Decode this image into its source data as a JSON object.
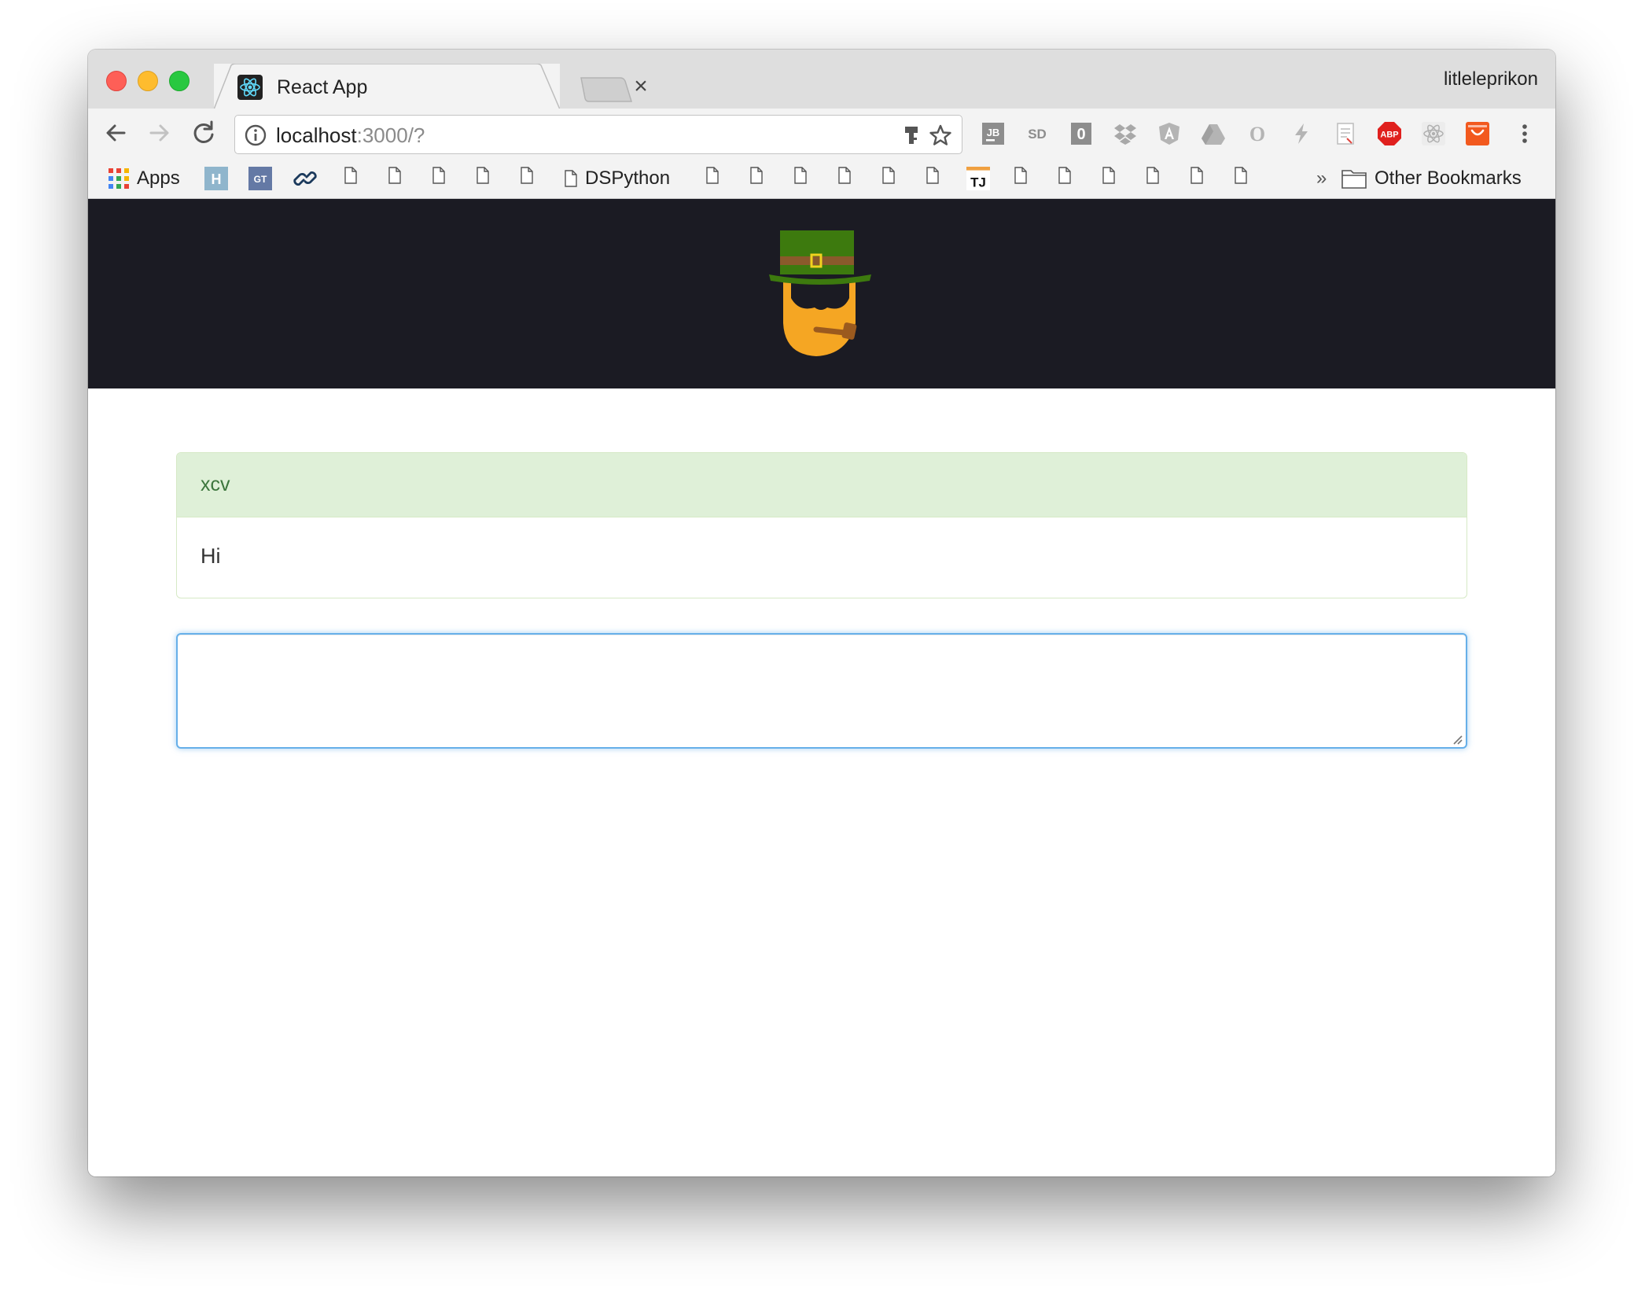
{
  "browser": {
    "tab": {
      "title": "React App",
      "close_glyph": "×"
    },
    "profile_name": "litleleprikon",
    "address": {
      "host": "localhost",
      "rest": ":3000/?"
    },
    "extensions": [
      "jetbrains-icon",
      "sd-icon",
      "zero-icon",
      "dropbox-icon",
      "angular-icon",
      "drive-icon",
      "opera-icon",
      "bolt-icon",
      "document-icon",
      "abp-icon",
      "react-devtools-icon",
      "aliexpress-icon"
    ],
    "extension_labels": {
      "jb": "JB",
      "sd": "SD",
      "zero": "0",
      "opera": "O",
      "abp": "ABP"
    }
  },
  "bookmarks": {
    "apps_label": "Apps",
    "h_label": "H",
    "gt_label": "GT",
    "dspython_label": "DSPython",
    "tj_label": "TJ",
    "overflow_glyph": "»",
    "other_label": "Other Bookmarks"
  },
  "message": {
    "title": "xcv",
    "body": "Hi"
  },
  "composer": {
    "value": "",
    "placeholder": ""
  },
  "colors": {
    "header_bg": "#1b1b23",
    "panel_heading_bg": "#dff0d8",
    "panel_title": "#3c763d",
    "focus_border": "#66afe9",
    "hat": "#3d7a0e",
    "beard": "#f5a623"
  }
}
